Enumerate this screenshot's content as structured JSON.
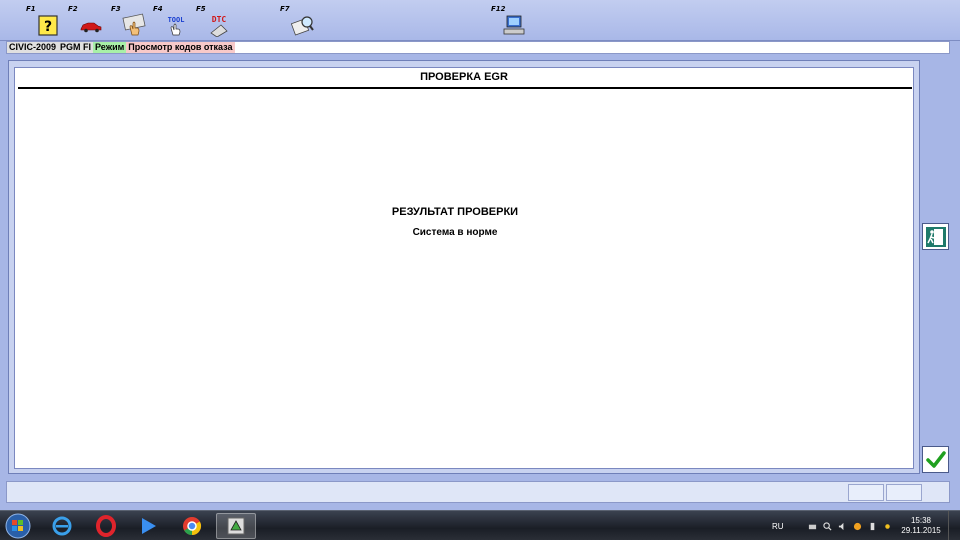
{
  "toolbar": {
    "keys": [
      {
        "label": "F1",
        "icon": "help-icon"
      },
      {
        "label": "F2",
        "icon": "car-icon"
      },
      {
        "label": "F3",
        "icon": "touch-icon"
      },
      {
        "label": "F4",
        "icon": "tool-icon"
      },
      {
        "label": "F5",
        "icon": "dtc-icon"
      },
      {
        "label": "F7",
        "icon": "magnifier-icon"
      },
      {
        "label": "F12",
        "icon": "computer-icon"
      }
    ],
    "tool_text": "TOOL",
    "dtc_text": "DTC"
  },
  "status": {
    "model": "CIVIC-2009",
    "system": "PGM FI",
    "mode_label": "Режим",
    "mode_value": "Просмотр кодов отказа"
  },
  "panel": {
    "title": "ПРОВЕРКА EGR",
    "result_title": "РЕЗУЛЬТАТ ПРОВЕРКИ",
    "result_text": "Система в норме"
  },
  "side_buttons": {
    "exit_icon": "exit-door-icon",
    "ok_icon": "checkmark-icon"
  },
  "taskbar": {
    "apps": [
      "internet-explorer-icon",
      "opera-icon",
      "media-player-icon",
      "chrome-icon",
      "hds-app-icon"
    ],
    "lang": "RU",
    "time": "15:38",
    "date": "29.11.2015"
  },
  "colors": {
    "background": "#a7b6e6",
    "mode_bg": "#a8f0a8",
    "mode_value_bg": "#f7c9c9",
    "ok_green": "#1fa01f",
    "exit_teal": "#1f7a6a"
  }
}
